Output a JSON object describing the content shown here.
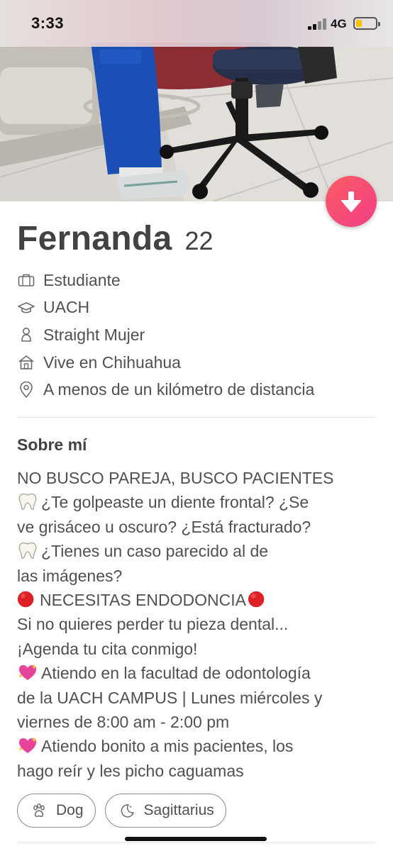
{
  "status_bar": {
    "time": "3:33",
    "network": "4G",
    "battery_level_fraction": 0.3,
    "battery_color": "#f5c400"
  },
  "photo": {
    "icon": "profile-photo"
  },
  "actions": {
    "collapse_icon": "arrow-down-icon",
    "accent_gradient": [
      "#fd5b63",
      "#ef3f86"
    ]
  },
  "profile": {
    "name": "Fernanda",
    "age": "22",
    "info": [
      {
        "icon": "briefcase-icon",
        "text": "Estudiante"
      },
      {
        "icon": "graduation-cap-icon",
        "text": "UACH"
      },
      {
        "icon": "person-icon",
        "text": "Straight Mujer"
      },
      {
        "icon": "home-icon",
        "text": "Vive en Chihuahua"
      },
      {
        "icon": "location-pin-icon",
        "text": "A menos de un kilómetro de distancia"
      }
    ]
  },
  "about": {
    "title": "Sobre mí",
    "lines": [
      "NO BUSCO PAREJA, BUSCO PACIENTES",
      "¿Te golpeaste un diente frontal? ¿Se",
      "ve grisáceo u oscuro?  ¿Está fracturado?",
      "¿Tienes un caso parecido al de",
      "las imágenes?",
      "NECESITAS ENDODONCIA",
      "Si no quieres perder tu pieza dental...",
      "¡Agenda tu cita conmigo!",
      "Atiendo en la facultad de odontología",
      "de la UACH CAMPUS | Lunes miércoles y",
      "viernes de 8:00 am - 2:00 pm",
      "Atiendo bonito a mis pacientes, los",
      "hago reír y les picho caguamas"
    ]
  },
  "tags": [
    {
      "icon": "paw-icon",
      "label": "Dog"
    },
    {
      "icon": "moon-icon",
      "label": "Sagittarius"
    }
  ]
}
